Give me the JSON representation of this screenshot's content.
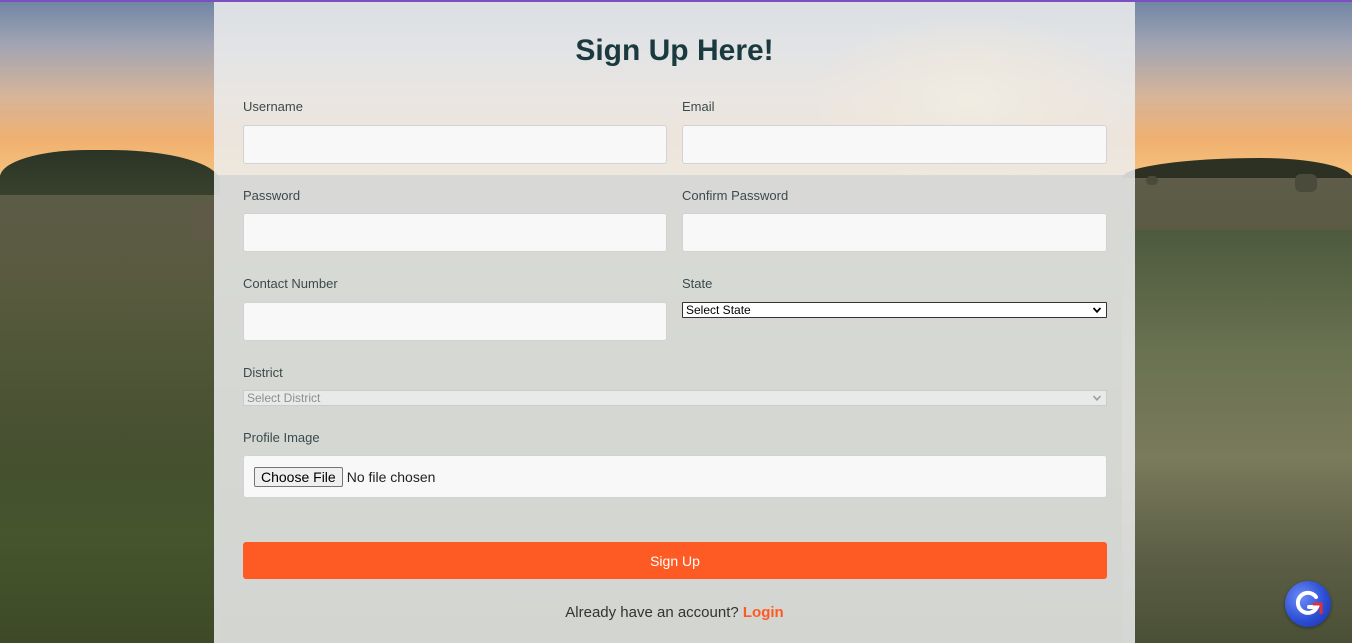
{
  "form": {
    "title": "Sign Up Here!",
    "username": {
      "label": "Username",
      "value": ""
    },
    "email": {
      "label": "Email",
      "value": ""
    },
    "password": {
      "label": "Password",
      "value": ""
    },
    "confirm_password": {
      "label": "Confirm Password",
      "value": ""
    },
    "contact_number": {
      "label": "Contact Number",
      "value": ""
    },
    "state": {
      "label": "State",
      "selected": "Select State"
    },
    "district": {
      "label": "District",
      "selected": "Select District"
    },
    "profile_image": {
      "label": "Profile Image",
      "button_label": "Choose File",
      "status": "No file chosen"
    },
    "submit_label": "Sign Up",
    "login_prompt": "Already have an account?",
    "login_link": "Login"
  },
  "colors": {
    "accent": "#fe5a23",
    "title": "#1b3a40",
    "top_border": "#7b4fbf"
  },
  "icons": {
    "badge": "g-logo-icon",
    "select_arrow": "chevron-down-icon"
  }
}
